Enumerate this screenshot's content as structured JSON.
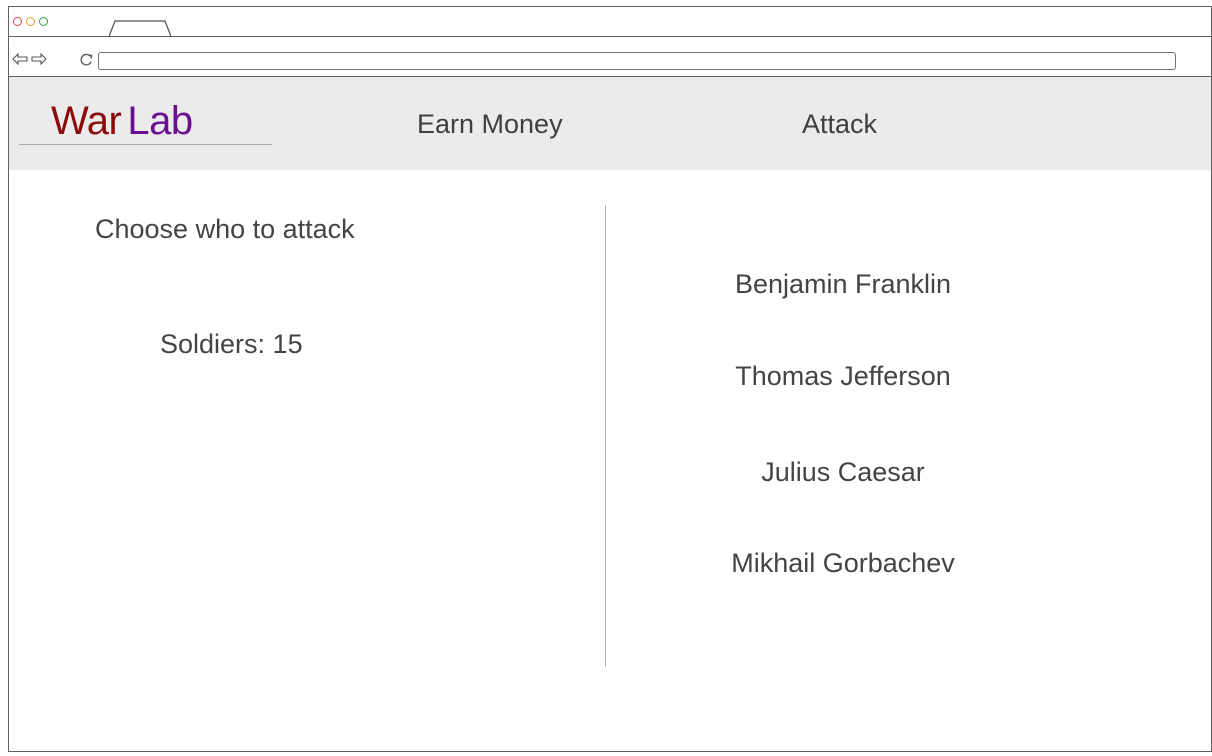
{
  "browser": {
    "tab_icon": "tab-shape",
    "back_icon": "arrow-left-icon",
    "forward_icon": "arrow-right-icon",
    "refresh_icon": "refresh-icon",
    "url": ""
  },
  "header": {
    "logo": {
      "part1": "War",
      "part2": "Lab",
      "part1_color": "#8b0a0a",
      "part2_color": "#6a0f8e"
    },
    "nav": {
      "earn_money": "Earn Money",
      "attack": "Attack"
    }
  },
  "left_panel": {
    "title": "Choose who to attack",
    "soldiers": "Soldiers: 15"
  },
  "targets": [
    "Benjamin Franklin",
    "Thomas Jefferson",
    "Julius Caesar",
    "Mikhail Gorbachev"
  ]
}
